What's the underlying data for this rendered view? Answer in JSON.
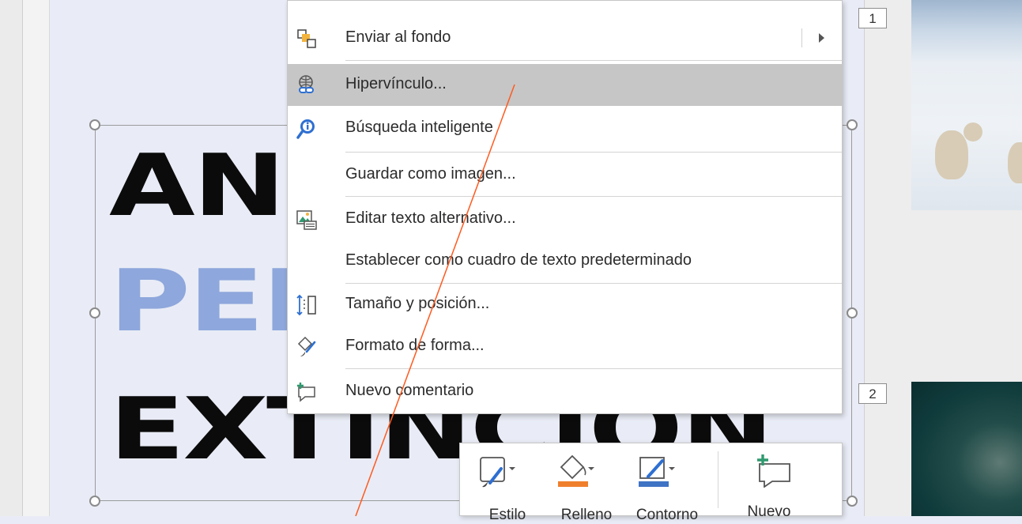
{
  "menu": {
    "items": [
      {
        "label": "Enviar al fondo",
        "icon": "send-to-back-icon",
        "has_submenu": true
      },
      {
        "label": "Hipervínculo...",
        "icon": "hyperlink-icon",
        "highlighted": true
      },
      {
        "label": "Búsqueda inteligente",
        "icon": "smart-lookup-icon"
      },
      {
        "label": "Guardar como imagen...",
        "icon": ""
      },
      {
        "label": "Editar texto alternativo...",
        "icon": "alt-text-icon"
      },
      {
        "label": "Establecer como cuadro de texto predeterminado",
        "icon": ""
      },
      {
        "label": "Tamaño y posición...",
        "icon": "size-position-icon"
      },
      {
        "label": "Formato de forma...",
        "icon": "format-shape-icon"
      },
      {
        "label": "Nuevo comentario",
        "icon": "new-comment-icon"
      }
    ]
  },
  "slide": {
    "words": [
      "ANI",
      "PEI",
      "EXTINCION"
    ]
  },
  "thumbnails": [
    {
      "number": "1"
    },
    {
      "number": "2"
    }
  ],
  "mini_toolbar": {
    "style_label": "Estilo",
    "fill_label": "Relleno",
    "outline_label": "Contorno",
    "new_comment_label": "Nuevo"
  },
  "colors": {
    "highlight": "#c6c6c6",
    "accent_blue": "#2e6fd1",
    "fill_orange": "#f07f2d",
    "outline_blue": "#3f73c4",
    "comment_green": "#2f9a6f",
    "word_blue": "#8ea7dc"
  }
}
